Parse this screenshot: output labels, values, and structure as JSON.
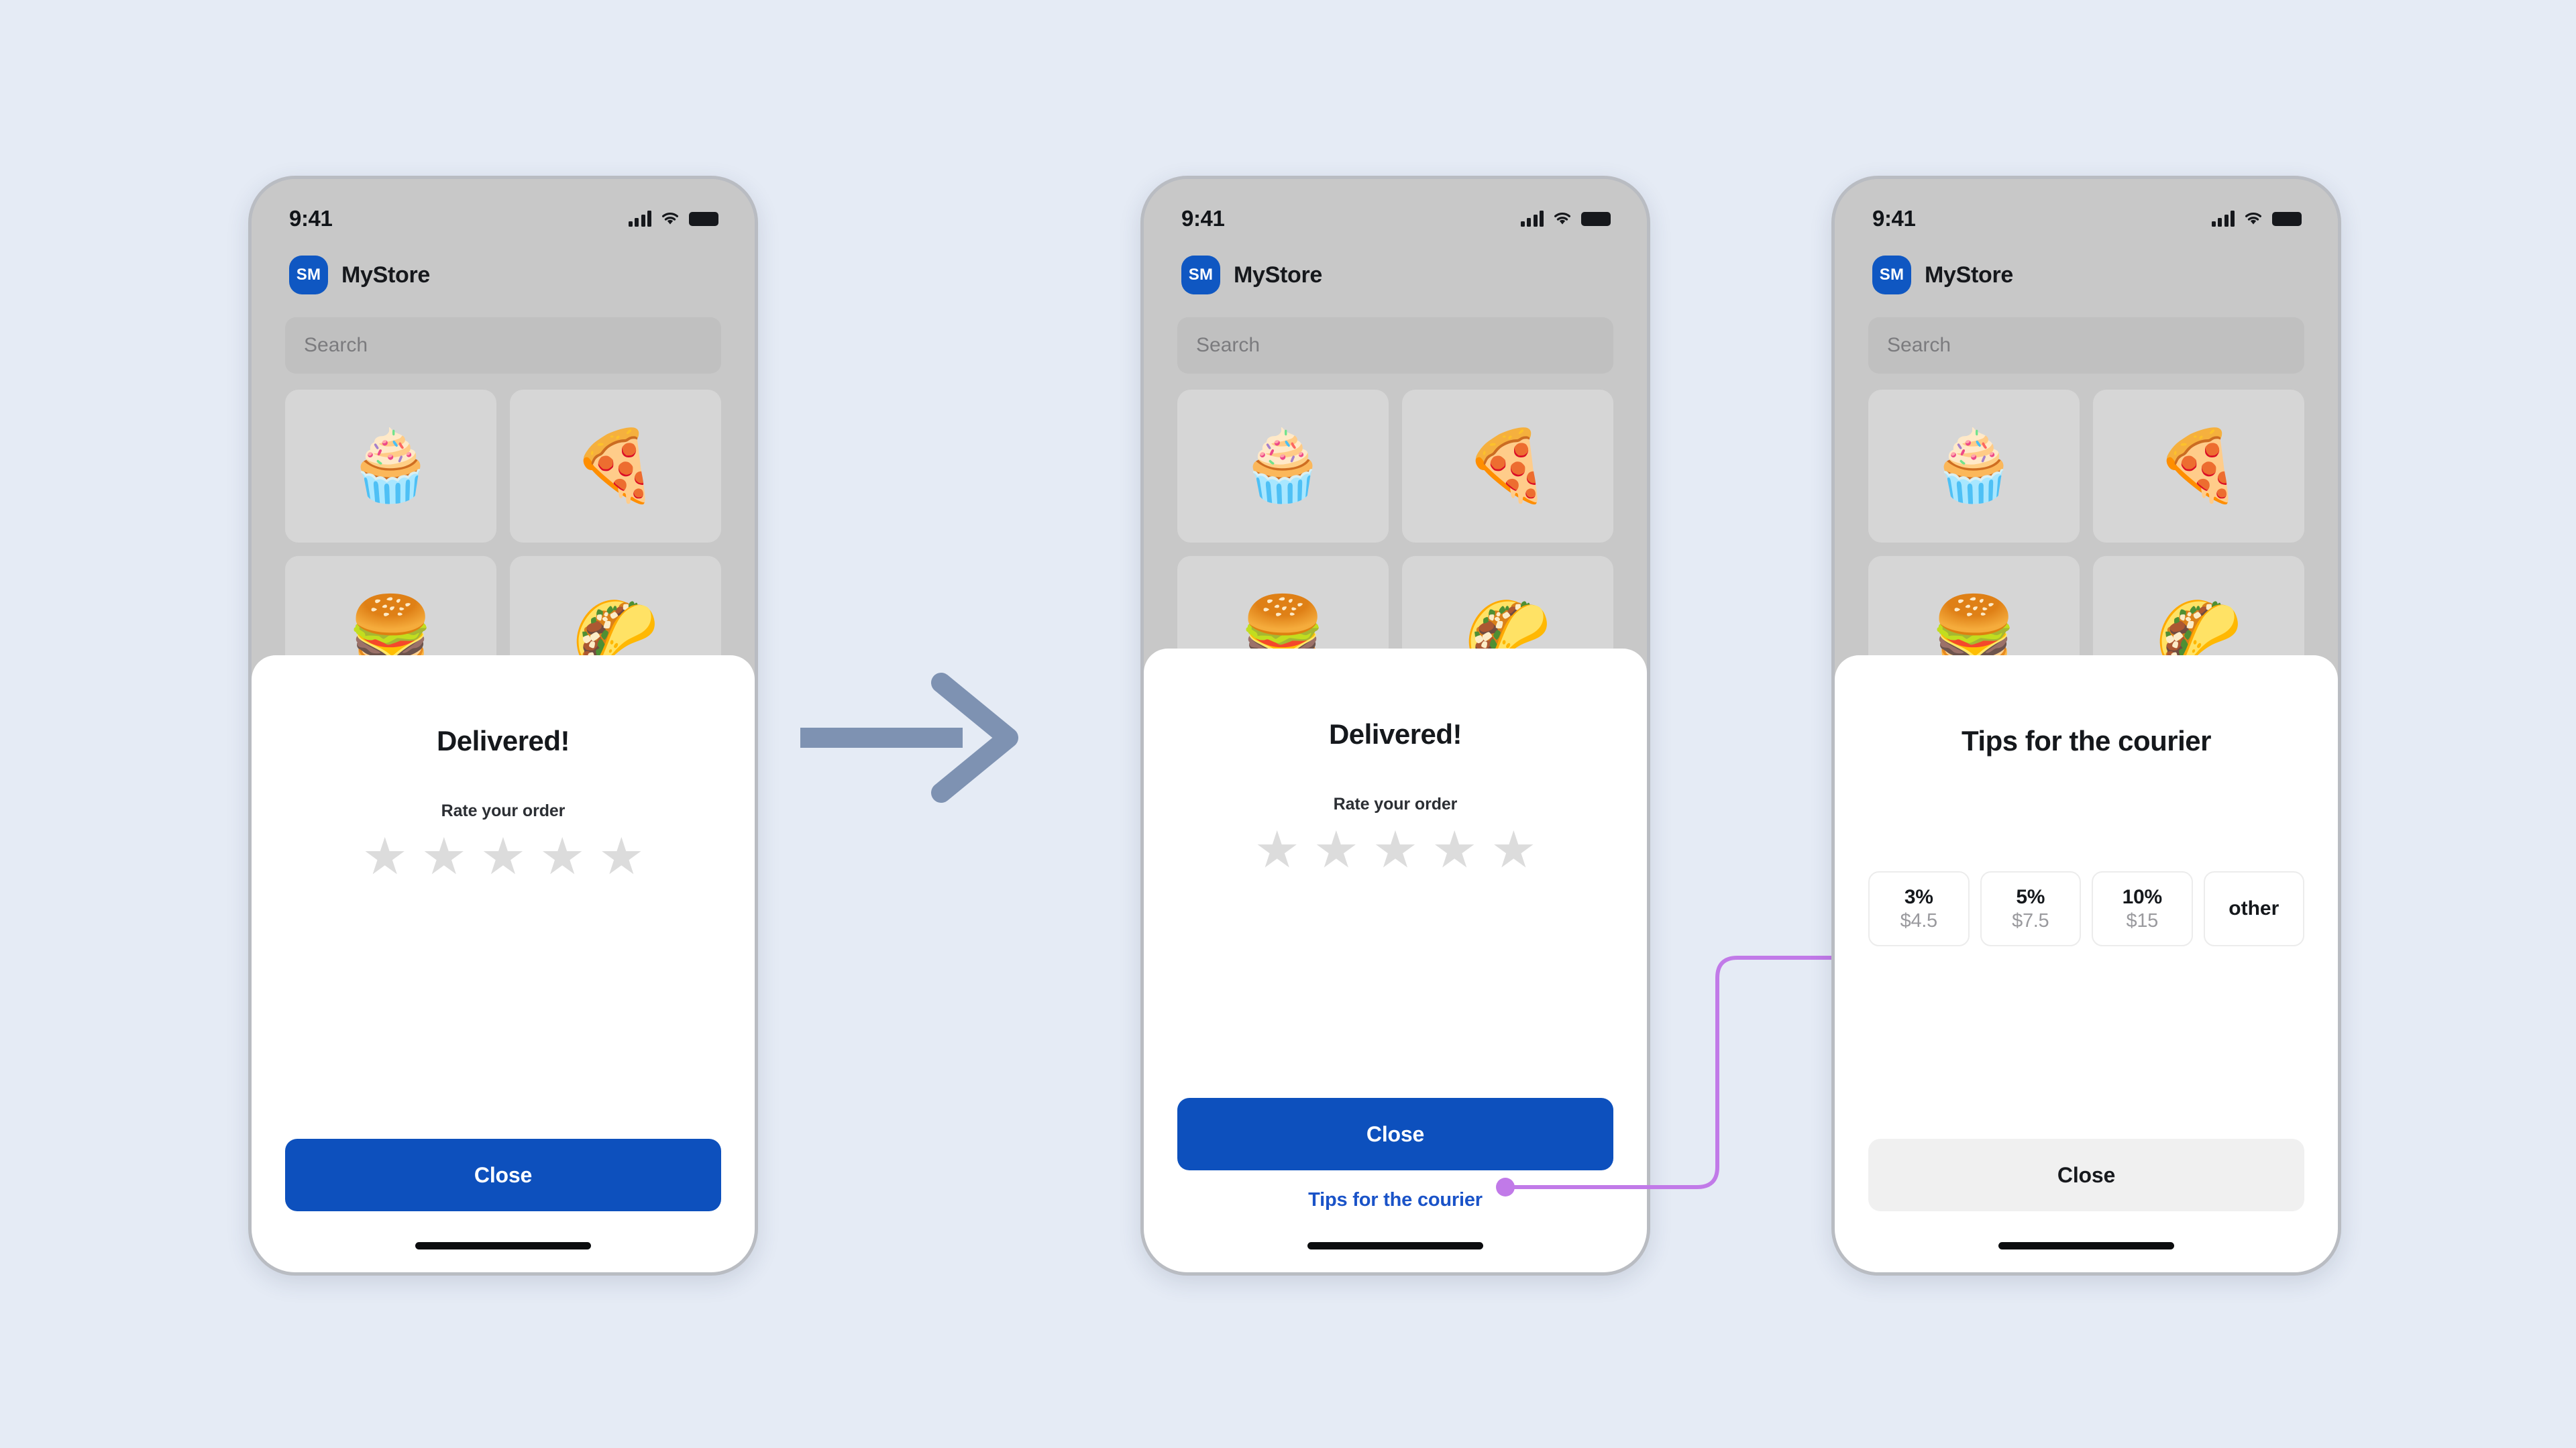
{
  "meta": {
    "background_color": "#e5ebf5",
    "accent_blue": "#0d50bd",
    "link_blue": "#1a53c8",
    "connector_purple": "#c17ae8",
    "arrow_gray": "#7e92b2",
    "star_gray": "#dcdcdc"
  },
  "status_bar": {
    "time": "9:41",
    "cellular_icon": "signal-bars-icon",
    "wifi_icon": "wifi-icon",
    "battery_icon": "battery-icon"
  },
  "app_header": {
    "avatar_initials": "SM",
    "store_name": "MyStore"
  },
  "search": {
    "placeholder": "Search",
    "value": ""
  },
  "product_grid": {
    "tiles": [
      {
        "name": "cupcake",
        "emoji": "🧁"
      },
      {
        "name": "pizza",
        "emoji": "🍕"
      },
      {
        "name": "burger",
        "emoji": "🍔"
      },
      {
        "name": "taco",
        "emoji": "🌮"
      }
    ]
  },
  "screen_1": {
    "modal_title": "Delivered!",
    "rate_label": "Rate your order",
    "stars": [
      "★",
      "★",
      "★",
      "★",
      "★"
    ],
    "close_label": "Close"
  },
  "screen_2": {
    "modal_title": "Delivered!",
    "rate_label": "Rate your order",
    "stars": [
      "★",
      "★",
      "★",
      "★",
      "★"
    ],
    "close_label": "Close",
    "tips_link_label": "Tips for the courier"
  },
  "screen_3": {
    "modal_title": "Tips for the courier",
    "tip_options": [
      {
        "percent": "3%",
        "amount": "$4.5"
      },
      {
        "percent": "5%",
        "amount": "$7.5"
      },
      {
        "percent": "10%",
        "amount": "$15"
      },
      {
        "percent": "other",
        "amount": ""
      }
    ],
    "close_label": "Close"
  },
  "flow": {
    "step_arrow_icon": "arrow-right-icon",
    "connector_icon": "connector-arrow-icon"
  }
}
